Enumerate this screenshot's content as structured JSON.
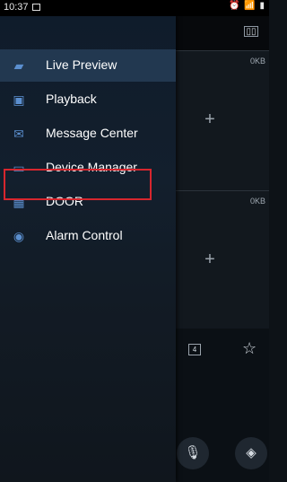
{
  "status_bar": {
    "time": "10:37",
    "right_icons": "⏰ 📶 ▮"
  },
  "preview": {
    "split_label": "▯▯",
    "panes": [
      {
        "rate": "0KB"
      },
      {
        "rate": "0KB"
      }
    ],
    "add_symbol": "+",
    "window_count": "4"
  },
  "menu": {
    "items": [
      {
        "label": "Live Preview",
        "icon": "camera-icon",
        "glyph": "▰"
      },
      {
        "label": "Playback",
        "icon": "playback-icon",
        "glyph": "▣"
      },
      {
        "label": "Message Center",
        "icon": "envelope-icon",
        "glyph": "✉"
      },
      {
        "label": "Device Manager",
        "icon": "device-icon",
        "glyph": "▭"
      },
      {
        "label": "DOOR",
        "icon": "door-icon",
        "glyph": "▦"
      },
      {
        "label": "Alarm Control",
        "icon": "alarm-icon",
        "glyph": "◉"
      }
    ],
    "active_index": 0,
    "highlighted_index": 3
  },
  "colors": {
    "accent": "#5b8fcf",
    "highlight_border": "#d7262e"
  }
}
